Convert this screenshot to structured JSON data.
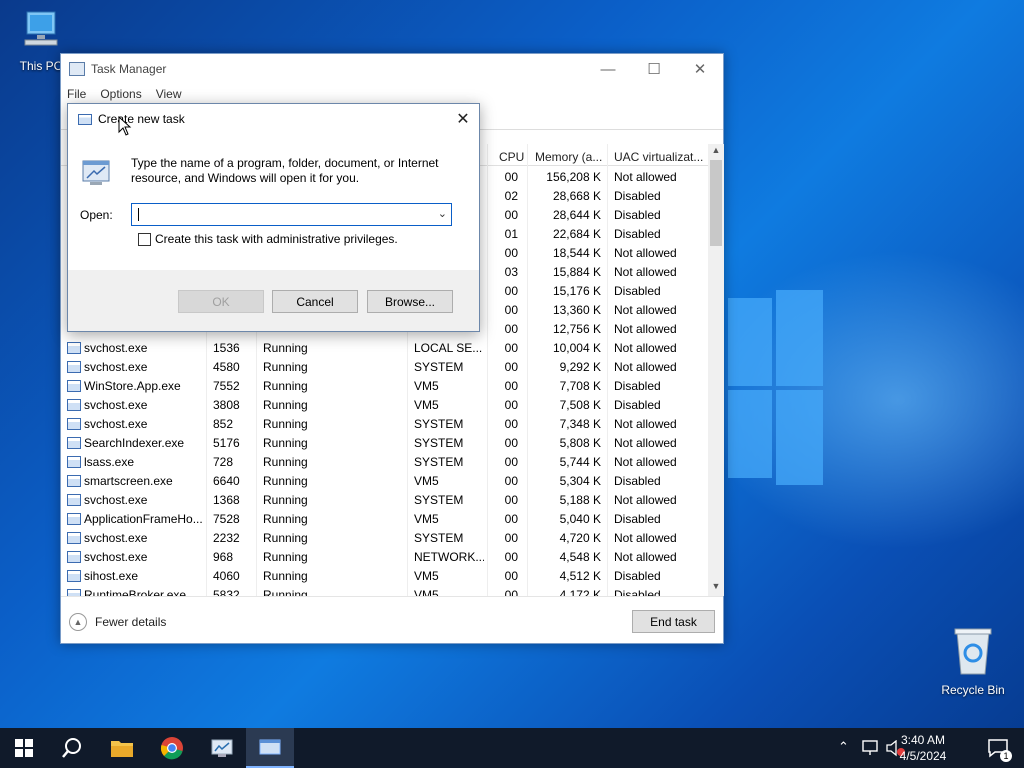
{
  "desktop": {
    "icons": [
      {
        "label": "This PC",
        "icon": "computer-icon"
      },
      {
        "label": "Recycle Bin",
        "icon": "recycle-bin-icon"
      }
    ]
  },
  "task_manager": {
    "title": "Task Manager",
    "menu": [
      "File",
      "Options",
      "View"
    ],
    "columns": {
      "cpu": "CPU",
      "memory": "Memory (a...",
      "uac": "UAC virtualizat..."
    },
    "rows": [
      {
        "name": "",
        "pid": "",
        "status": "",
        "user": "",
        "cpu": "00",
        "mem": "156,208 K",
        "uac": "Not allowed"
      },
      {
        "name": "",
        "pid": "",
        "status": "",
        "user": "",
        "cpu": "02",
        "mem": "28,668 K",
        "uac": "Disabled"
      },
      {
        "name": "",
        "pid": "",
        "status": "",
        "user": "",
        "cpu": "00",
        "mem": "28,644 K",
        "uac": "Disabled"
      },
      {
        "name": "",
        "pid": "",
        "status": "",
        "user": "",
        "cpu": "01",
        "mem": "22,684 K",
        "uac": "Disabled"
      },
      {
        "name": "",
        "pid": "",
        "status": "",
        "user": "",
        "cpu": "00",
        "mem": "18,544 K",
        "uac": "Not allowed"
      },
      {
        "name": "",
        "pid": "",
        "status": "",
        "user": "",
        "cpu": "03",
        "mem": "15,884 K",
        "uac": "Not allowed"
      },
      {
        "name": "",
        "pid": "",
        "status": "",
        "user": "",
        "cpu": "00",
        "mem": "15,176 K",
        "uac": "Disabled"
      },
      {
        "name": "",
        "pid": "",
        "status": "",
        "user": "",
        "cpu": "00",
        "mem": "13,360 K",
        "uac": "Not allowed"
      },
      {
        "name": "",
        "pid": "",
        "status": "",
        "user": "",
        "cpu": "00",
        "mem": "12,756 K",
        "uac": "Not allowed"
      },
      {
        "name": "svchost.exe",
        "pid": "1536",
        "status": "Running",
        "user": "LOCAL SE...",
        "cpu": "00",
        "mem": "10,004 K",
        "uac": "Not allowed"
      },
      {
        "name": "svchost.exe",
        "pid": "4580",
        "status": "Running",
        "user": "SYSTEM",
        "cpu": "00",
        "mem": "9,292 K",
        "uac": "Not allowed"
      },
      {
        "name": "WinStore.App.exe",
        "pid": "7552",
        "status": "Running",
        "user": "VM5",
        "cpu": "00",
        "mem": "7,708 K",
        "uac": "Disabled"
      },
      {
        "name": "svchost.exe",
        "pid": "3808",
        "status": "Running",
        "user": "VM5",
        "cpu": "00",
        "mem": "7,508 K",
        "uac": "Disabled"
      },
      {
        "name": "svchost.exe",
        "pid": "852",
        "status": "Running",
        "user": "SYSTEM",
        "cpu": "00",
        "mem": "7,348 K",
        "uac": "Not allowed"
      },
      {
        "name": "SearchIndexer.exe",
        "pid": "5176",
        "status": "Running",
        "user": "SYSTEM",
        "cpu": "00",
        "mem": "5,808 K",
        "uac": "Not allowed"
      },
      {
        "name": "lsass.exe",
        "pid": "728",
        "status": "Running",
        "user": "SYSTEM",
        "cpu": "00",
        "mem": "5,744 K",
        "uac": "Not allowed"
      },
      {
        "name": "smartscreen.exe",
        "pid": "6640",
        "status": "Running",
        "user": "VM5",
        "cpu": "00",
        "mem": "5,304 K",
        "uac": "Disabled"
      },
      {
        "name": "svchost.exe",
        "pid": "1368",
        "status": "Running",
        "user": "SYSTEM",
        "cpu": "00",
        "mem": "5,188 K",
        "uac": "Not allowed"
      },
      {
        "name": "ApplicationFrameHo...",
        "pid": "7528",
        "status": "Running",
        "user": "VM5",
        "cpu": "00",
        "mem": "5,040 K",
        "uac": "Disabled"
      },
      {
        "name": "svchost.exe",
        "pid": "2232",
        "status": "Running",
        "user": "SYSTEM",
        "cpu": "00",
        "mem": "4,720 K",
        "uac": "Not allowed"
      },
      {
        "name": "svchost.exe",
        "pid": "968",
        "status": "Running",
        "user": "NETWORK...",
        "cpu": "00",
        "mem": "4,548 K",
        "uac": "Not allowed"
      },
      {
        "name": "sihost.exe",
        "pid": "4060",
        "status": "Running",
        "user": "VM5",
        "cpu": "00",
        "mem": "4,512 K",
        "uac": "Disabled"
      },
      {
        "name": "RuntimeBroker.exe",
        "pid": "5832",
        "status": "Running",
        "user": "VM5",
        "cpu": "00",
        "mem": "4,172 K",
        "uac": "Disabled"
      }
    ],
    "fewer_details": "Fewer details",
    "end_task": "End task"
  },
  "dialog": {
    "title": "Create new task",
    "message": "Type the name of a program, folder, document, or Internet resource, and Windows will open it for you.",
    "open_label": "Open:",
    "open_value": "",
    "admin_checkbox": "Create this task with administrative privileges.",
    "ok": "OK",
    "cancel": "Cancel",
    "browse": "Browse..."
  },
  "taskbar": {
    "time": "3:40 AM",
    "date": "4/5/2024",
    "notification_count": "1"
  }
}
